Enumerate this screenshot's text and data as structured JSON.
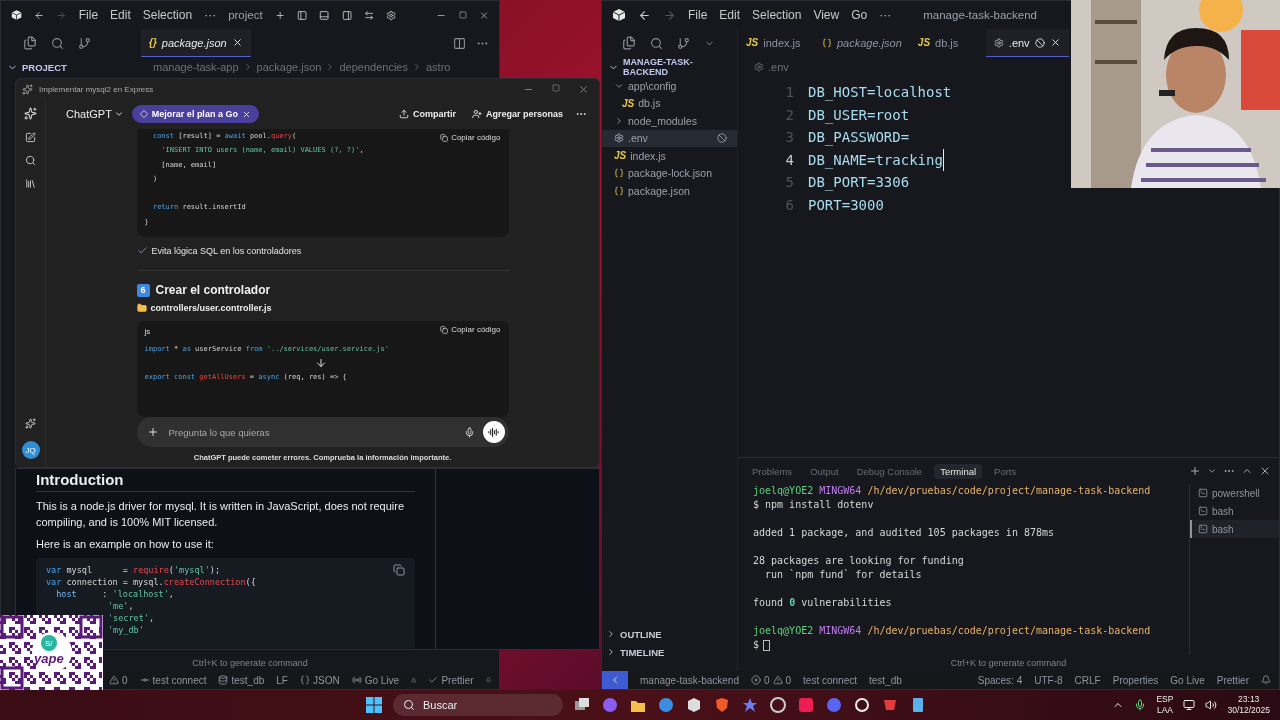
{
  "left_editor": {
    "menu": [
      "File",
      "Edit",
      "Selection",
      "···"
    ],
    "title": "project",
    "tab": {
      "icon": "{}",
      "label": "package.json",
      "selected": true
    },
    "breadcrumbs": [
      "manage-task-app",
      "package.json",
      "dependencies",
      "astro"
    ],
    "explorer_title": "PROJECT",
    "hint": "Ctrl+K to generate command",
    "status_bar": [
      "0",
      "test connect",
      "test_db",
      "LF",
      "JSON",
      "Go Live",
      "Prettier"
    ]
  },
  "browser": {
    "heading": "Introduction",
    "paragraphs": [
      "This is a node.js driver for mysql. It is written in JavaScript, does not require compiling, and is 100% MIT licensed.",
      "Here is an example on how to use it:"
    ],
    "code": [
      {
        "kind": "code",
        "tokens": [
          {
            "text": "var",
            "kind": "keyword"
          },
          {
            "text": " mysql      = ",
            "kind": "plain"
          },
          {
            "text": "require",
            "kind": "function"
          },
          {
            "text": "(",
            "kind": "plain"
          },
          {
            "text": "'mysql'",
            "kind": "string"
          },
          {
            "text": ");",
            "kind": "plain"
          }
        ]
      },
      {
        "kind": "code",
        "tokens": [
          {
            "text": "var",
            "kind": "keyword"
          },
          {
            "text": " connection = mysql.",
            "kind": "plain"
          },
          {
            "text": "createConnection",
            "kind": "function"
          },
          {
            "text": "({",
            "kind": "plain"
          }
        ]
      },
      {
        "kind": "code",
        "tokens": [
          {
            "text": "  host",
            "kind": "property"
          },
          {
            "text": "     : ",
            "kind": "plain"
          },
          {
            "text": "'localhost'",
            "kind": "string"
          },
          {
            "text": ",",
            "kind": "plain"
          }
        ]
      },
      {
        "kind": "partial",
        "tokens": [
          {
            "text": "'me'",
            "kind": "string"
          },
          {
            "text": ",",
            "kind": "plain"
          }
        ]
      },
      {
        "kind": "partial",
        "tokens": [
          {
            "text": "'secret'",
            "kind": "string"
          },
          {
            "text": ",",
            "kind": "plain"
          }
        ]
      },
      {
        "kind": "partial",
        "tokens": [
          {
            "text": "'my_db'",
            "kind": "string"
          }
        ]
      }
    ]
  },
  "chat": {
    "window_title": "Implementar mysql2 en Express",
    "model": "ChatGPT",
    "upgrade": "Mejorar el plan a Go",
    "share": "Compartir",
    "add_people": "Agregar personas",
    "avatar": "JQ",
    "code_block_1": {
      "copy": "Copiar código",
      "lines": [
        {
          "kind": "code",
          "tokens": [
            {
              "text": "  const",
              "kind": "keyword"
            },
            {
              "text": " [result] = ",
              "kind": "plain"
            },
            {
              "text": "await",
              "kind": "keyword"
            },
            {
              "text": " pool.",
              "kind": "plain"
            },
            {
              "text": "query",
              "kind": "function"
            },
            {
              "text": "(",
              "kind": "plain"
            }
          ]
        },
        {
          "kind": "code",
          "tokens": [
            {
              "text": "    'INSERT INTO users (name, email) VALUES (?, ?)'",
              "kind": "string"
            },
            {
              "text": ",",
              "kind": "plain"
            }
          ]
        },
        {
          "kind": "code",
          "tokens": [
            {
              "text": "    [name, email]",
              "kind": "plain"
            }
          ]
        },
        {
          "kind": "code",
          "tokens": [
            {
              "text": "  )",
              "kind": "plain"
            }
          ]
        },
        {
          "kind": "blank"
        },
        {
          "kind": "code",
          "tokens": [
            {
              "text": "  return",
              "kind": "keyword"
            },
            {
              "text": " result.insertId",
              "kind": "plain"
            }
          ]
        },
        {
          "kind": "code",
          "tokens": [
            {
              "text": "}",
              "kind": "plain"
            }
          ]
        }
      ]
    },
    "check_note": "Evita lógica SQL en los controladores",
    "section": {
      "number": "6",
      "title": "Crear el controlador"
    },
    "file_path": "controllers/user.controller.js",
    "code_block_2": {
      "language": "js",
      "copy": "Copiar código",
      "lines": [
        {
          "kind": "code",
          "tokens": [
            {
              "text": "import",
              "kind": "keyword"
            },
            {
              "text": " * ",
              "kind": "plain"
            },
            {
              "text": "as",
              "kind": "keyword"
            },
            {
              "text": " userService ",
              "kind": "plain"
            },
            {
              "text": "from",
              "kind": "keyword"
            },
            {
              "text": " '../services/user.service.js'",
              "kind": "string"
            }
          ]
        },
        {
          "kind": "blank"
        },
        {
          "kind": "code",
          "tokens": [
            {
              "text": "export const",
              "kind": "keyword"
            },
            {
              "text": " getAllUsers",
              "kind": "function"
            },
            {
              "text": " = ",
              "kind": "plain"
            },
            {
              "text": "async",
              "kind": "keyword"
            },
            {
              "text": " (req, res) => {",
              "kind": "plain"
            }
          ]
        }
      ]
    },
    "input": {
      "placeholder": "Pregunta lo que quieras"
    },
    "disclaimer": "ChatGPT puede cometer errores. Comprueba la información importante."
  },
  "right_editor": {
    "menu": [
      "File",
      "Edit",
      "Selection",
      "View",
      "Go",
      "···"
    ],
    "title": "manage-task-backend",
    "tabs": [
      {
        "kind": "js",
        "icon": "JS",
        "label": "index.js",
        "selected": false
      },
      {
        "kind": "json",
        "label": "package.json",
        "selected": false
      },
      {
        "kind": "js",
        "icon": "JS",
        "label": "db.js",
        "selected": false
      },
      {
        "kind": "env",
        "label": ".env",
        "selected": true
      }
    ],
    "breadcrumb": ".env",
    "explorer_title": "MANAGE-TASK-BACKEND",
    "tree": [
      {
        "kind": "folder",
        "label": "app\\config",
        "expanded": true,
        "selected": false,
        "children": [
          {
            "kind": "js",
            "icon": "JS",
            "label": "db.js",
            "selected": false
          }
        ]
      },
      {
        "kind": "folder",
        "label": "node_modules",
        "expanded": false,
        "selected": false
      },
      {
        "kind": "env",
        "label": ".env",
        "selected": true
      },
      {
        "kind": "js",
        "icon": "JS",
        "label": "index.js",
        "selected": false
      },
      {
        "kind": "json",
        "label": "package-lock.json",
        "selected": false
      },
      {
        "kind": "json",
        "label": "package.json",
        "selected": false
      }
    ],
    "lines": [
      {
        "number": "1",
        "text": "DB_HOST=localhost",
        "selected": false
      },
      {
        "number": "2",
        "text": "DB_USER=root",
        "selected": false
      },
      {
        "number": "3",
        "text": "DB_PASSWORD=",
        "selected": false
      },
      {
        "number": "4",
        "text": "DB_NAME=tracking",
        "selected": true
      },
      {
        "number": "5",
        "text": "DB_PORT=3306",
        "selected": false
      },
      {
        "number": "6",
        "text": "PORT=3000",
        "selected": false
      }
    ],
    "panel_tabs": [
      {
        "label": "Problems",
        "selected": false
      },
      {
        "label": "Output",
        "selected": false
      },
      {
        "label": "Debug Console",
        "selected": false
      },
      {
        "label": "Terminal",
        "selected": true
      },
      {
        "label": "Ports",
        "selected": false
      }
    ],
    "terminal": [
      {
        "kind": "code",
        "tokens": [
          {
            "text": "joelq@YOE2 ",
            "kind": "user"
          },
          {
            "text": "MINGW64 ",
            "kind": "host"
          },
          {
            "text": "/h/dev/pruebas/code/project/manage-task-backend",
            "kind": "path"
          }
        ]
      },
      {
        "kind": "code",
        "tokens": [
          {
            "text": "$ npm install dotenv",
            "kind": "plain"
          }
        ]
      },
      {
        "kind": "blank"
      },
      {
        "kind": "code",
        "tokens": [
          {
            "text": "added 1 package, and audited 105 packages in 878ms",
            "kind": "plain"
          }
        ]
      },
      {
        "kind": "blank"
      },
      {
        "kind": "code",
        "tokens": [
          {
            "text": "28 packages are looking for funding",
            "kind": "plain"
          }
        ]
      },
      {
        "kind": "code",
        "tokens": [
          {
            "text": "  run `npm fund` for details",
            "kind": "plain"
          }
        ]
      },
      {
        "kind": "blank"
      },
      {
        "kind": "code",
        "tokens": [
          {
            "text": "found ",
            "kind": "plain"
          },
          {
            "text": "0",
            "kind": "number"
          },
          {
            "text": " vulnerabilities",
            "kind": "plain"
          }
        ]
      },
      {
        "kind": "blank"
      },
      {
        "kind": "code",
        "tokens": [
          {
            "text": "joelq@YOE2 ",
            "kind": "user"
          },
          {
            "text": "MINGW64 ",
            "kind": "host"
          },
          {
            "text": "/h/dev/pruebas/code/project/manage-task-backend",
            "kind": "path"
          }
        ]
      },
      {
        "kind": "prompt",
        "tokens": [
          {
            "text": "$",
            "kind": "plain"
          }
        ]
      }
    ],
    "sessions": [
      {
        "label": "powershell",
        "selected": false
      },
      {
        "label": "bash",
        "selected": false
      },
      {
        "label": "bash",
        "selected": true
      }
    ],
    "outline": "OUTLINE",
    "timeline": "TIMELINE",
    "hint": "Ctrl+K to generate command",
    "status_bar": {
      "remote": "manage-task-backend",
      "errors": "0",
      "warnings": "0",
      "items": [
        "test connect",
        "test_db",
        "Spaces: 4",
        "UTF-8",
        "CRLF",
        "Properties",
        "Go Live",
        "Prettier"
      ]
    }
  },
  "qr_overlay": {
    "currency": "S/",
    "label": "yape"
  },
  "taskbar": {
    "search": "Buscar",
    "language": "ESP",
    "layout": "LAA",
    "time": "23:13",
    "date": "30/12/2025"
  }
}
